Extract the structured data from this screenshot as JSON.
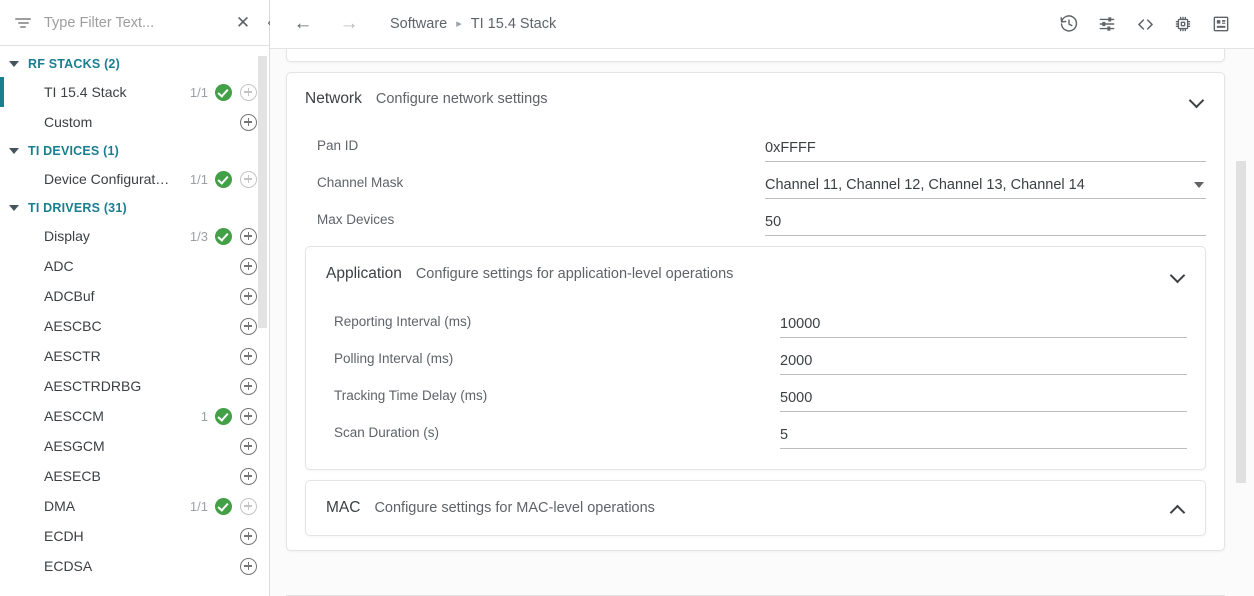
{
  "sidebar": {
    "filter": {
      "placeholder": "Type Filter Text...",
      "value": "",
      "clear_label": "✕",
      "collapse_label": "«"
    },
    "groups": [
      {
        "label": "RF STACKS (2)",
        "items": [
          {
            "label": "TI 15.4 Stack",
            "count": "1/1",
            "check": true,
            "plus": true,
            "plus_dim": true,
            "selected": true
          },
          {
            "label": "Custom",
            "count": "",
            "check": false,
            "plus": true,
            "plus_dim": false,
            "selected": false
          }
        ]
      },
      {
        "label": "TI DEVICES (1)",
        "items": [
          {
            "label": "Device Configurat…",
            "count": "1/1",
            "check": true,
            "plus": true,
            "plus_dim": true,
            "selected": false
          }
        ]
      },
      {
        "label": "TI DRIVERS (31)",
        "items": [
          {
            "label": "Display",
            "count": "1/3",
            "check": true,
            "plus": true,
            "plus_dim": false,
            "selected": false
          },
          {
            "label": "ADC",
            "count": "",
            "check": false,
            "plus": true,
            "plus_dim": false,
            "selected": false
          },
          {
            "label": "ADCBuf",
            "count": "",
            "check": false,
            "plus": true,
            "plus_dim": false,
            "selected": false
          },
          {
            "label": "AESCBC",
            "count": "",
            "check": false,
            "plus": true,
            "plus_dim": false,
            "selected": false
          },
          {
            "label": "AESCTR",
            "count": "",
            "check": false,
            "plus": true,
            "plus_dim": false,
            "selected": false
          },
          {
            "label": "AESCTRDRBG",
            "count": "",
            "check": false,
            "plus": true,
            "plus_dim": false,
            "selected": false
          },
          {
            "label": "AESCCM",
            "count": "1",
            "check": true,
            "plus": true,
            "plus_dim": false,
            "selected": false
          },
          {
            "label": "AESGCM",
            "count": "",
            "check": false,
            "plus": true,
            "plus_dim": false,
            "selected": false
          },
          {
            "label": "AESECB",
            "count": "",
            "check": false,
            "plus": true,
            "plus_dim": false,
            "selected": false
          },
          {
            "label": "DMA",
            "count": "1/1",
            "check": true,
            "plus": true,
            "plus_dim": true,
            "selected": false
          },
          {
            "label": "ECDH",
            "count": "",
            "check": false,
            "plus": true,
            "plus_dim": false,
            "selected": false
          },
          {
            "label": "ECDSA",
            "count": "",
            "check": false,
            "plus": true,
            "plus_dim": false,
            "selected": false
          }
        ]
      }
    ]
  },
  "topbar": {
    "back_label": "←",
    "forward_label": "→",
    "breadcrumb_root": "Software",
    "breadcrumb_sep": "▸",
    "breadcrumb_current": "TI 15.4 Stack",
    "tools": [
      {
        "name": "history-icon",
        "title": "History"
      },
      {
        "name": "sliders-icon",
        "title": "Settings"
      },
      {
        "name": "code-icon",
        "title": "Show Generated Files"
      },
      {
        "name": "chip-icon",
        "title": "Device View"
      },
      {
        "name": "panel-icon",
        "title": "Board View"
      }
    ]
  },
  "sections": {
    "network": {
      "title": "Network",
      "description": "Configure network settings",
      "chevron": "down",
      "fields": [
        {
          "label": "Pan ID",
          "value": "0xFFFF",
          "type": "text"
        },
        {
          "label": "Channel Mask",
          "value": "Channel 11, Channel 12, Channel 13, Channel 14",
          "type": "select"
        },
        {
          "label": "Max Devices",
          "value": "50",
          "type": "text"
        }
      ]
    },
    "application": {
      "title": "Application",
      "description": "Configure settings for application-level operations",
      "chevron": "down",
      "fields": [
        {
          "label": "Reporting Interval (ms)",
          "value": "10000",
          "type": "text"
        },
        {
          "label": "Polling Interval (ms)",
          "value": "2000",
          "type": "text"
        },
        {
          "label": "Tracking Time Delay (ms)",
          "value": "5000",
          "type": "text"
        },
        {
          "label": "Scan Duration (s)",
          "value": "5",
          "type": "text"
        }
      ]
    },
    "mac": {
      "title": "MAC",
      "description": "Configure settings for MAC-level operations",
      "chevron": "up",
      "fields": []
    }
  },
  "colors": {
    "accent_teal": "#1a7e90",
    "status_green": "#43a047",
    "text_primary": "#3c4043",
    "text_secondary": "#5f6368"
  }
}
